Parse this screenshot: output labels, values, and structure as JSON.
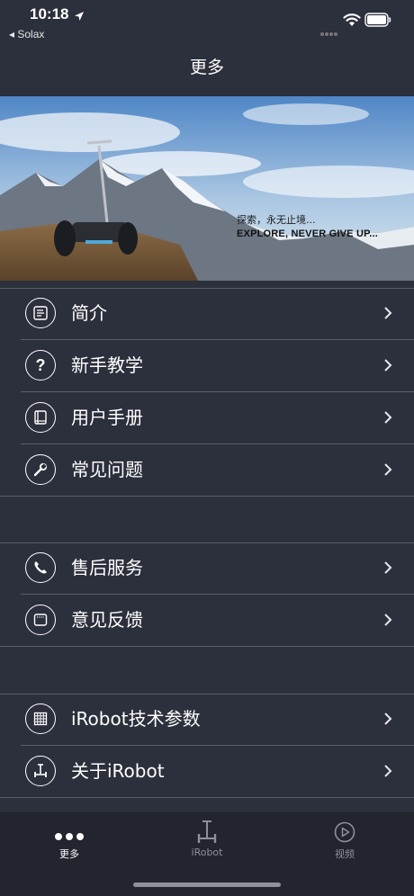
{
  "status": {
    "time": "10:18",
    "back_app": "◂ Solax"
  },
  "nav": {
    "title": "更多"
  },
  "banner": {
    "tagline_cn": "探索，永无止境...",
    "tagline_en": "EXPLORE, NEVER GIVE UP..."
  },
  "menu": {
    "group1": [
      {
        "label": "简介",
        "icon": "document-icon"
      },
      {
        "label": "新手教学",
        "icon": "question-icon"
      },
      {
        "label": "用户手册",
        "icon": "book-icon"
      },
      {
        "label": "常见问题",
        "icon": "wrench-icon"
      }
    ],
    "group2": [
      {
        "label": "售后服务",
        "icon": "phone-icon"
      },
      {
        "label": "意见反馈",
        "icon": "feedback-icon"
      }
    ],
    "group3": [
      {
        "label": "iRobot技术参数",
        "icon": "grid-icon"
      },
      {
        "label": "关于iRobot",
        "icon": "scooter-icon"
      }
    ]
  },
  "tabbar": {
    "tabs": [
      {
        "label": "更多",
        "icon": "more-dots-icon",
        "active": true
      },
      {
        "label": "iRobot",
        "icon": "scooter-icon",
        "active": false
      },
      {
        "label": "视频",
        "icon": "play-icon",
        "active": false
      }
    ]
  },
  "colors": {
    "background": "#2c2f3c",
    "separator": "#5c5f6a",
    "tabbar": "#22242e",
    "active_tab": "#ffffff",
    "inactive_tab": "#8e9099"
  }
}
